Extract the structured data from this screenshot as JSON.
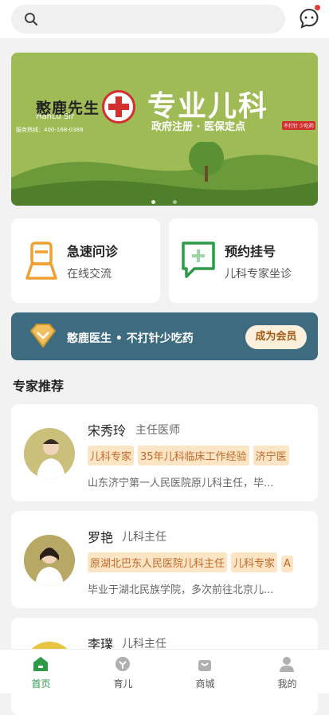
{
  "header": {
    "search_placeholder": "",
    "chat_icon": "chat-bubble-icon"
  },
  "banner": {
    "brand_name": "憨鹿先生",
    "brand_en": "HanLu Sir",
    "hotline": "服务热线：400-168-0388",
    "title": "专业儿科",
    "subtitle": "政府注册 · 医保定点",
    "tag": "不打针 少吃药"
  },
  "quick": [
    {
      "title": "急速问诊",
      "sub": "在线交流"
    },
    {
      "title": "预约挂号",
      "sub": "儿科专家坐诊"
    }
  ],
  "member": {
    "text": "憨鹿医生 • 不打针少吃药",
    "button": "成为会员"
  },
  "section_title": "专家推荐",
  "doctors": [
    {
      "name": "宋秀玲",
      "role": "主任医师",
      "tags": [
        "儿科专家",
        "35年儿科临床工作经验",
        "济宁医"
      ],
      "desc": "山东济宁第一人民医院原儿科主任，毕..."
    },
    {
      "name": "罗艳",
      "role": "儿科主任",
      "tags": [
        "原湖北巴东人民医院儿科主任",
        "儿科专家",
        "A"
      ],
      "desc": "毕业于湖北民族学院，多次前往北京儿..."
    },
    {
      "name": "李璞",
      "role": "儿科主任",
      "tags": [],
      "desc": ""
    }
  ],
  "tabs": [
    {
      "label": "首页",
      "active": true
    },
    {
      "label": "育儿",
      "active": false
    },
    {
      "label": "商城",
      "active": false
    },
    {
      "label": "我的",
      "active": false
    }
  ],
  "colors": {
    "accent": "#2e9a48",
    "banner": "#9fbb55",
    "member": "#3d6b80",
    "tag_bg": "#fce5c4",
    "tag_text": "#c0692a"
  }
}
